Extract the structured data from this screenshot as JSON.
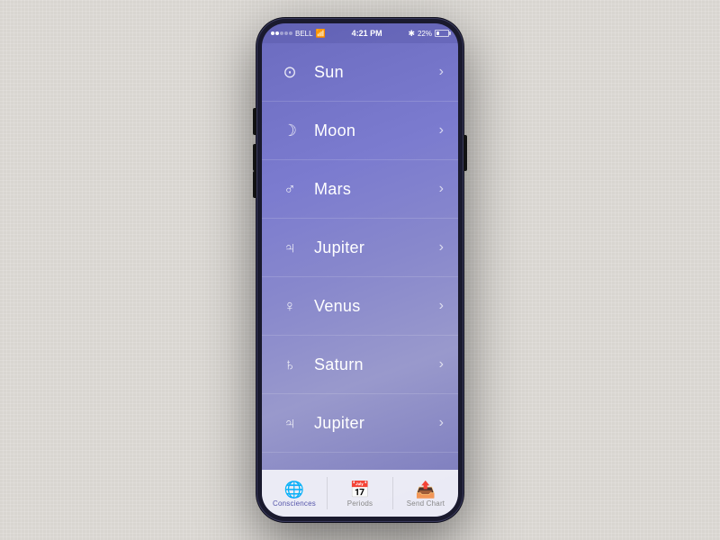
{
  "status_bar": {
    "carrier": "BELL",
    "time": "4:21 PM",
    "battery_percent": "22%"
  },
  "planets": [
    {
      "id": "sun",
      "symbol": "⊙",
      "name": "Sun"
    },
    {
      "id": "moon",
      "symbol": "☽",
      "name": "Moon"
    },
    {
      "id": "mars",
      "symbol": "♂",
      "name": "Mars"
    },
    {
      "id": "jupiter1",
      "symbol": "♃",
      "name": "Jupiter"
    },
    {
      "id": "venus",
      "symbol": "♀",
      "name": "Venus"
    },
    {
      "id": "saturn",
      "symbol": "♄",
      "name": "Saturn"
    },
    {
      "id": "jupiter2",
      "symbol": "♃",
      "name": "Jupiter"
    }
  ],
  "tabs": [
    {
      "id": "consciences",
      "icon": "🌐",
      "label": "Consciences",
      "active": true
    },
    {
      "id": "periods",
      "icon": "📅",
      "label": "Periods",
      "active": false
    },
    {
      "id": "send-chart",
      "icon": "📤",
      "label": "Send Chart",
      "active": false
    }
  ]
}
